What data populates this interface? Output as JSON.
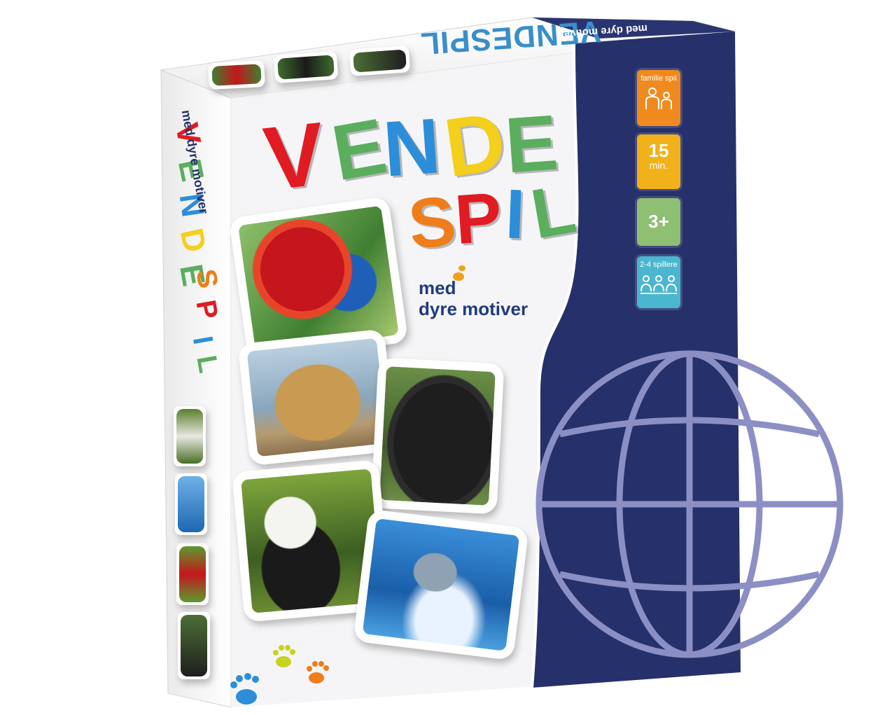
{
  "product": {
    "title_line1": [
      "V",
      "E",
      "N",
      "D",
      "E"
    ],
    "title_line2": [
      "S",
      "P",
      "I",
      "L"
    ],
    "tagline_line1": "med",
    "tagline_line2": "dyre motiver",
    "top_title": "VENDESPIL",
    "top_tagline": "med dyre motiver",
    "spine_line1": [
      "V",
      "E",
      "N",
      "D",
      "E"
    ],
    "spine_line2": [
      "S",
      "P",
      "I",
      "L"
    ],
    "spine_tagline": "med dyre motiver"
  },
  "badges": [
    {
      "caption": "familie spil",
      "icon": "two-people-icon",
      "color": "#f08a1e"
    },
    {
      "big": "15",
      "sub": "min.",
      "icon": "clock",
      "color": "#f0b11a"
    },
    {
      "big": "3+",
      "icon": "age",
      "color": "#8fbf72"
    },
    {
      "caption": "2-4 spillere",
      "icon": "three-people-icon",
      "color": "#4ab6cf"
    }
  ],
  "cards": [
    {
      "animal": "parrot",
      "photo_colors": [
        "#5b9c2f",
        "#c4161c"
      ]
    },
    {
      "animal": "cheetah",
      "photo_colors": [
        "#9ab6c8",
        "#c89a52"
      ]
    },
    {
      "animal": "gorilla",
      "photo_colors": [
        "#4c6e35",
        "#1e1e1e"
      ]
    },
    {
      "animal": "panda",
      "photo_colors": [
        "#5a7f2b",
        "#f4f4f0"
      ]
    },
    {
      "animal": "dolphin",
      "photo_colors": [
        "#1e67b3",
        "#6db1e6"
      ]
    }
  ],
  "colors": {
    "panel": "#26306b",
    "globe": "#8b8fc4",
    "red": "#e01b22",
    "green": "#5aae5e",
    "blue": "#2c8ed8",
    "yellow": "#f4cf1b",
    "orange": "#ef7d1a"
  }
}
